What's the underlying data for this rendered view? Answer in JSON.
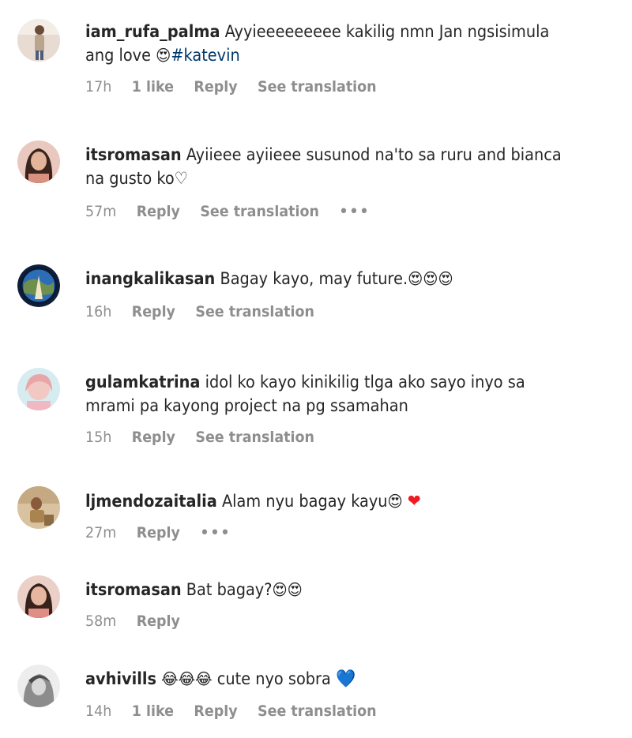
{
  "comments": [
    {
      "username": "iam_rufa_palma",
      "text": "Ayyieeeeeeeee kakilig nmn Jan ngsisimula ang love ",
      "emoji": "😍",
      "hashtag": "#katevin",
      "time": "17h",
      "likes": "1 like",
      "reply": "Reply",
      "translation": "See translation"
    },
    {
      "username": "itsromasan",
      "text": "Ayiieee ayiieee susunod na'to sa ruru and bianca na gusto ko♡",
      "time": "57m",
      "reply": "Reply",
      "translation": "See translation",
      "more": "•••"
    },
    {
      "username": "inangkalikasan",
      "text": "Bagay kayo, may future.",
      "emoji": "😍😍😍",
      "time": "16h",
      "reply": "Reply",
      "translation": "See translation"
    },
    {
      "username": "gulamkatrina",
      "text": "idol ko kayo kinikilig tlga ako sayo inyo sa mrami pa kayong project na pg ssamahan",
      "time": "15h",
      "reply": "Reply",
      "translation": "See translation"
    },
    {
      "username": "ljmendozaitalia",
      "text": "Alam nyu bagay kayu",
      "emoji": "😍",
      "heart": "❤",
      "time": "27m",
      "reply": "Reply",
      "more": "•••"
    },
    {
      "username": "itsromasan",
      "text": "Bat bagay?",
      "emoji": "😍😍",
      "time": "58m",
      "reply": "Reply"
    },
    {
      "username": "avhivills",
      "emoji": "😂😂😂",
      "text": " cute nyo sobra ",
      "heart": "💙",
      "time": "14h",
      "likes": "1 like",
      "reply": "Reply",
      "translation": "See translation"
    }
  ]
}
